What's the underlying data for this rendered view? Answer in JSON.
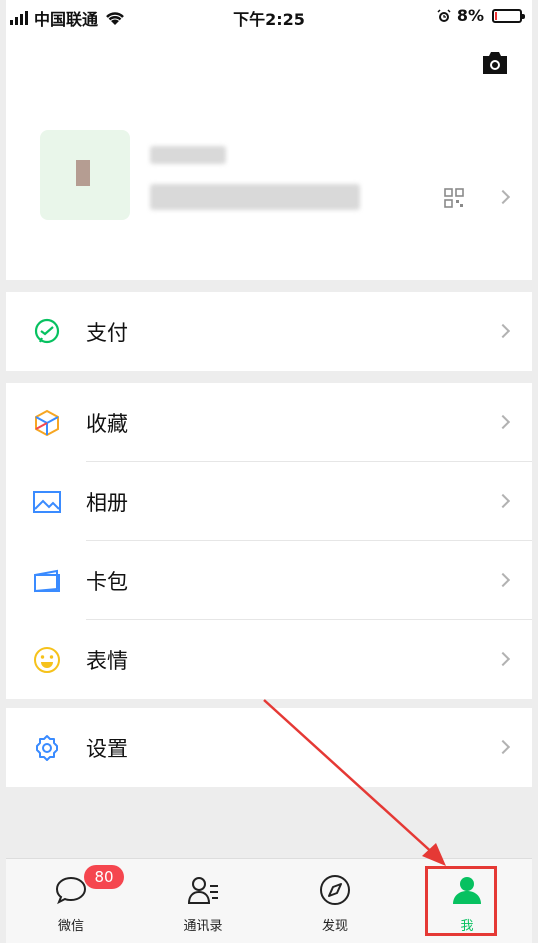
{
  "status_bar": {
    "carrier": "中国联通",
    "time": "下午2:25",
    "battery": "8%"
  },
  "menu": {
    "pay": {
      "label": "支付"
    },
    "group2": [
      {
        "label": "收藏",
        "icon": "favorites-icon"
      },
      {
        "label": "相册",
        "icon": "album-icon"
      },
      {
        "label": "卡包",
        "icon": "card-wallet-icon"
      },
      {
        "label": "表情",
        "icon": "sticker-icon"
      }
    ],
    "settings": {
      "label": "设置"
    }
  },
  "tabbar": {
    "chats": {
      "label": "微信",
      "badge": "80"
    },
    "contacts": {
      "label": "通讯录"
    },
    "discover": {
      "label": "发现"
    },
    "me": {
      "label": "我"
    }
  },
  "colors": {
    "accent": "#07c160",
    "badge": "#f5464f",
    "highlight": "#e53935"
  }
}
